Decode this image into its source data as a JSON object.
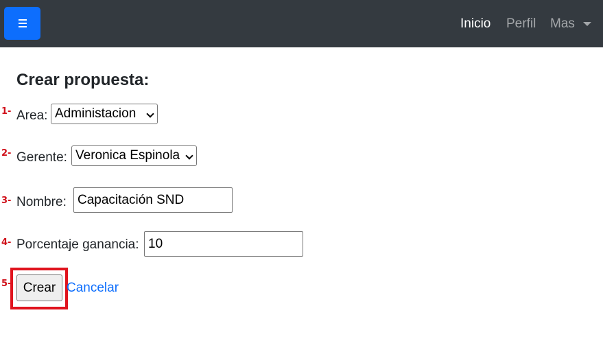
{
  "navbar": {
    "menu_icon": "hamburger-icon",
    "links": [
      {
        "label": "Inicio"
      },
      {
        "label": "Perfil"
      },
      {
        "label": "Mas"
      }
    ]
  },
  "form": {
    "title": "Crear propuesta:",
    "steps": [
      "1-",
      "2-",
      "3-",
      "4-",
      "5-"
    ],
    "area": {
      "label": "Area:",
      "selected": "Administacion"
    },
    "gerente": {
      "label": "Gerente:",
      "selected": "Veronica Espinola"
    },
    "nombre": {
      "label": "Nombre:",
      "value": "Capacitación SND"
    },
    "porcentaje": {
      "label": "Porcentaje ganancia:",
      "value": "10"
    },
    "submit_label": "Crear",
    "cancel_label": "Cancelar"
  },
  "colors": {
    "navbar_bg": "#343a40",
    "primary": "#0d6efd",
    "annotation": "#e0141e"
  }
}
